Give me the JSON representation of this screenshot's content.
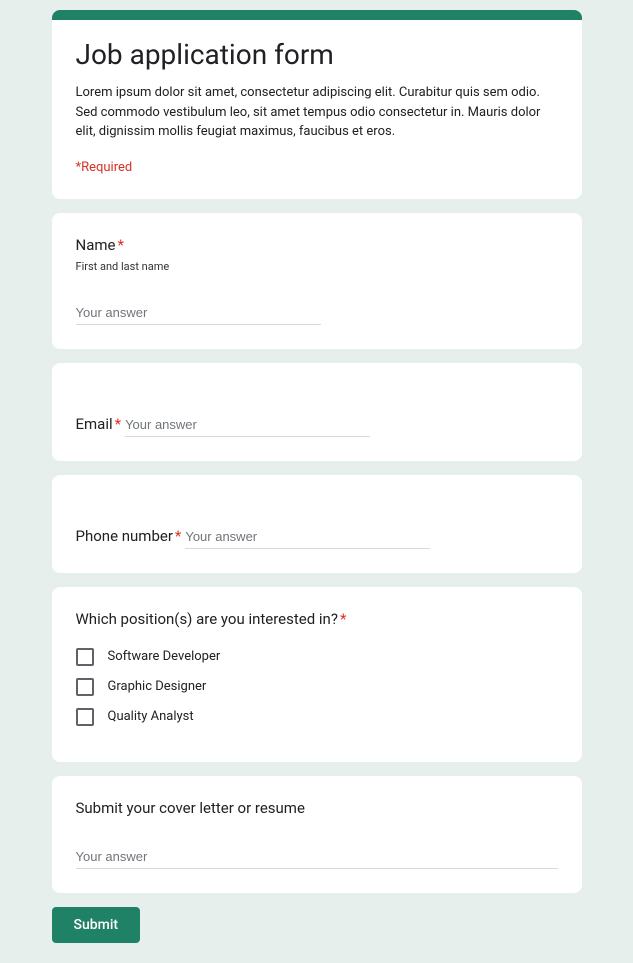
{
  "header": {
    "title": "Job application form",
    "description": "Lorem ipsum dolor sit amet, consectetur adipiscing elit. Curabitur quis sem odio. Sed commodo vestibulum leo, sit amet tempus odio consectetur in. Mauris dolor elit, dignissim mollis feugiat maximus, faucibus et eros.",
    "required_note": "*Required"
  },
  "questions": {
    "name": {
      "label": "Name",
      "sublabel": "First and last name",
      "placeholder": "Your answer"
    },
    "email": {
      "label": "Email",
      "placeholder": "Your answer"
    },
    "phone": {
      "label": "Phone number",
      "placeholder": "Your answer"
    },
    "positions": {
      "label": "Which position(s) are you interested in?",
      "options": [
        "Software Developer",
        "Graphic Designer",
        "Quality Analyst"
      ]
    },
    "cover": {
      "label": "Submit your cover letter or resume",
      "placeholder": "Your answer"
    }
  },
  "submit_label": "Submit",
  "asterisk": "*"
}
